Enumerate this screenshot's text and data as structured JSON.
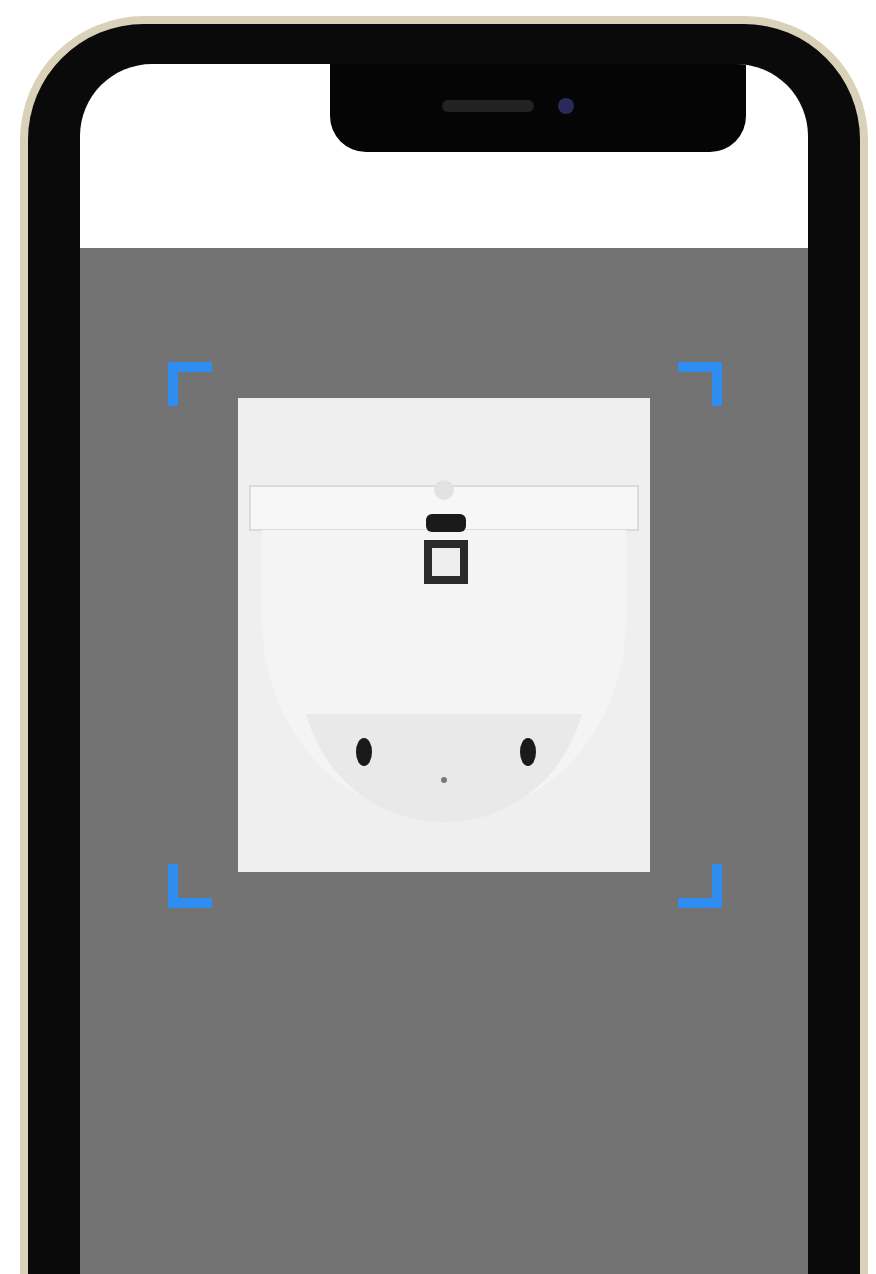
{
  "scanner": {
    "kind": "qr_frame"
  }
}
